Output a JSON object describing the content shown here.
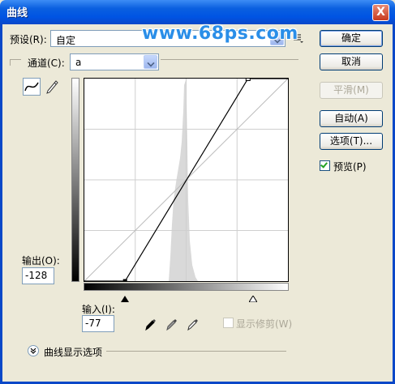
{
  "window": {
    "title": "曲线",
    "close_glyph": "X"
  },
  "watermark": "www.68ps.com",
  "preset": {
    "label": "预设(R):",
    "value": "自定"
  },
  "channel": {
    "label": "通道(C):",
    "value": "a"
  },
  "buttons": {
    "ok": "确定",
    "cancel": "取消",
    "smooth": "平滑(M)",
    "auto": "自动(A)",
    "options": "选项(T)..."
  },
  "preview": {
    "label": "预览(P)",
    "checked": true
  },
  "output": {
    "label": "输出(O):",
    "value": "-128"
  },
  "input": {
    "label": "输入(I):",
    "value": "-77"
  },
  "show_clipping": {
    "label": "显示修剪(W)",
    "checked": false
  },
  "curve_display_options": "曲线显示选项",
  "icons": {
    "preset_menu": "list-menu-icon",
    "curve_tool": "curve-edit-icon",
    "pencil_tool": "pencil-icon",
    "black_eyedropper": "black-eyedropper-icon",
    "gray_eyedropper": "gray-eyedropper-icon",
    "white_eyedropper": "white-eyedropper-icon",
    "expand": "chevron-double-down-icon"
  },
  "curve_points": [
    {
      "input": -77,
      "output": -128
    },
    {
      "input": 77,
      "output": 127
    }
  ],
  "colors": {
    "title_bar": "#0054e3",
    "accent": "#316ac5",
    "dialog_bg": "#ece9d8"
  }
}
